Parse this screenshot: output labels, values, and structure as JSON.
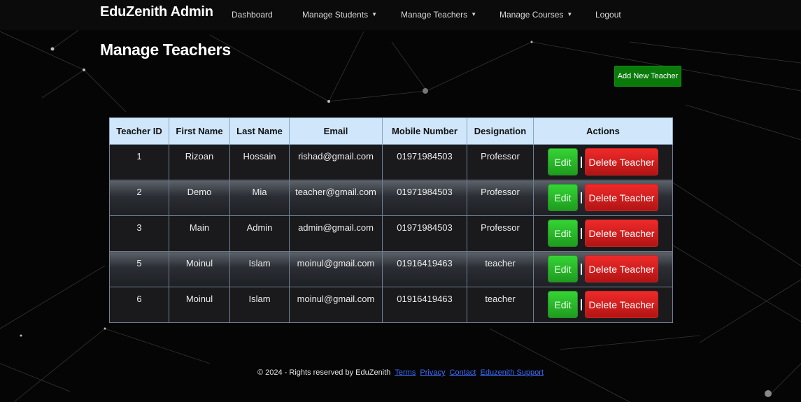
{
  "nav": {
    "brand": "EduZenith Admin",
    "items": [
      {
        "label": "Dashboard",
        "dropdown": false
      },
      {
        "label": "Manage Students",
        "dropdown": true
      },
      {
        "label": "Manage Teachers",
        "dropdown": true
      },
      {
        "label": "Manage Courses",
        "dropdown": true
      },
      {
        "label": "Logout",
        "dropdown": false
      }
    ]
  },
  "page": {
    "title": "Manage Teachers",
    "add_button": "Add New Teacher"
  },
  "table": {
    "columns": [
      "Teacher ID",
      "First Name",
      "Last Name",
      "Email",
      "Mobile Number",
      "Designation",
      "Actions"
    ],
    "rows": [
      {
        "id": "1",
        "first": "Rizoan",
        "last": "Hossain",
        "email": "rishad@gmail.com",
        "mobile": "01971984503",
        "designation": "Professor"
      },
      {
        "id": "2",
        "first": "Demo",
        "last": "Mia",
        "email": "teacher@gmail.com",
        "mobile": "01971984503",
        "designation": "Professor"
      },
      {
        "id": "3",
        "first": "Main",
        "last": "Admin",
        "email": "admin@gmail.com",
        "mobile": "01971984503",
        "designation": "Professor"
      },
      {
        "id": "5",
        "first": "Moinul",
        "last": "Islam",
        "email": "moinul@gmail.com",
        "mobile": "01916419463",
        "designation": "teacher"
      },
      {
        "id": "6",
        "first": "Moinul",
        "last": "Islam",
        "email": "moinul@gmail.com",
        "mobile": "01916419463",
        "designation": "teacher"
      }
    ],
    "edit_label": "Edit",
    "delete_label": "Delete Teacher"
  },
  "footer": {
    "text": "© 2024 - Rights reserved by EduZenith",
    "links": [
      "Terms",
      "Privacy",
      "Contact",
      "Eduzenith Support"
    ]
  },
  "colors": {
    "add_button": "#0a7a0a",
    "edit_button": "#2ab82a",
    "delete_button": "#d61e1e",
    "table_header": "#cfe6fb",
    "footer_link": "#3b6cff"
  }
}
